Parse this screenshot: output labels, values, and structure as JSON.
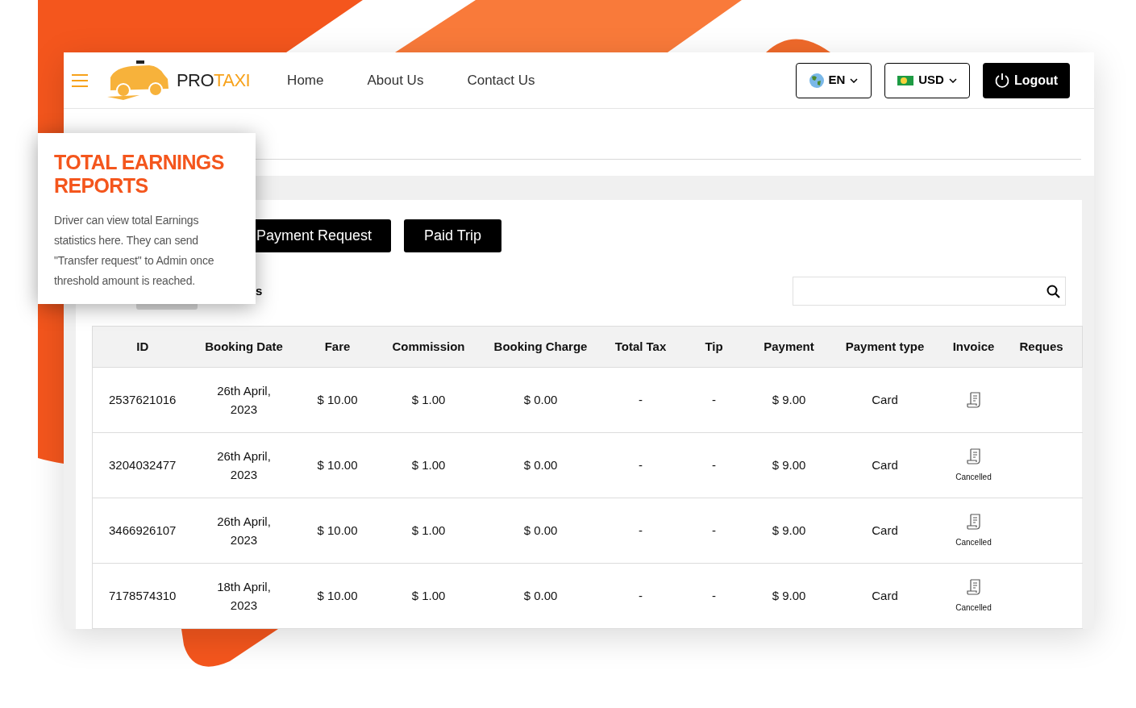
{
  "header": {
    "logo": {
      "dark_part": "PRO",
      "accent_part": "TAXI"
    },
    "nav": [
      "Home",
      "About Us",
      "Contact Us"
    ],
    "language": "EN",
    "currency": "USD",
    "logout": "Logout"
  },
  "callout": {
    "title": "TOTAL EARNINGS REPORTS",
    "text": "Driver can view total Earnings statistics here. They can send \"Transfer request\" to Admin once threshold amount is reached."
  },
  "tab_buttons": [
    "Payment Request",
    "Paid Trip"
  ],
  "label_fragment": "s",
  "table": {
    "columns": [
      "ID",
      "Booking Date",
      "Fare",
      "Commission",
      "Booking Charge",
      "Total Tax",
      "Tip",
      "Payment",
      "Payment type",
      "Invoice",
      "Reques"
    ],
    "rows": [
      {
        "id": "2537621016",
        "date": "26th April, 2023",
        "fare": "$ 10.00",
        "commission": "$ 1.00",
        "booking_charge": "$ 0.00",
        "total_tax": "-",
        "tip": "-",
        "payment": "$ 9.00",
        "payment_type": "Card"
      },
      {
        "id": "3204032477",
        "date": "26th April, 2023",
        "fare": "$ 10.00",
        "commission": "$ 1.00",
        "booking_charge": "$ 0.00",
        "total_tax": "-",
        "tip": "-",
        "payment": "$ 9.00",
        "payment_type": "Card",
        "invoice_status": "Cancelled"
      },
      {
        "id": "3466926107",
        "date": "26th April, 2023",
        "fare": "$ 10.00",
        "commission": "$ 1.00",
        "booking_charge": "$ 0.00",
        "total_tax": "-",
        "tip": "-",
        "payment": "$ 9.00",
        "payment_type": "Card",
        "invoice_status": "Cancelled"
      },
      {
        "id": "7178574310",
        "date": "18th April, 2023",
        "fare": "$ 10.00",
        "commission": "$ 1.00",
        "booking_charge": "$ 0.00",
        "total_tax": "-",
        "tip": "-",
        "payment": "$ 9.00",
        "payment_type": "Card",
        "invoice_status": "Cancelled"
      }
    ]
  }
}
